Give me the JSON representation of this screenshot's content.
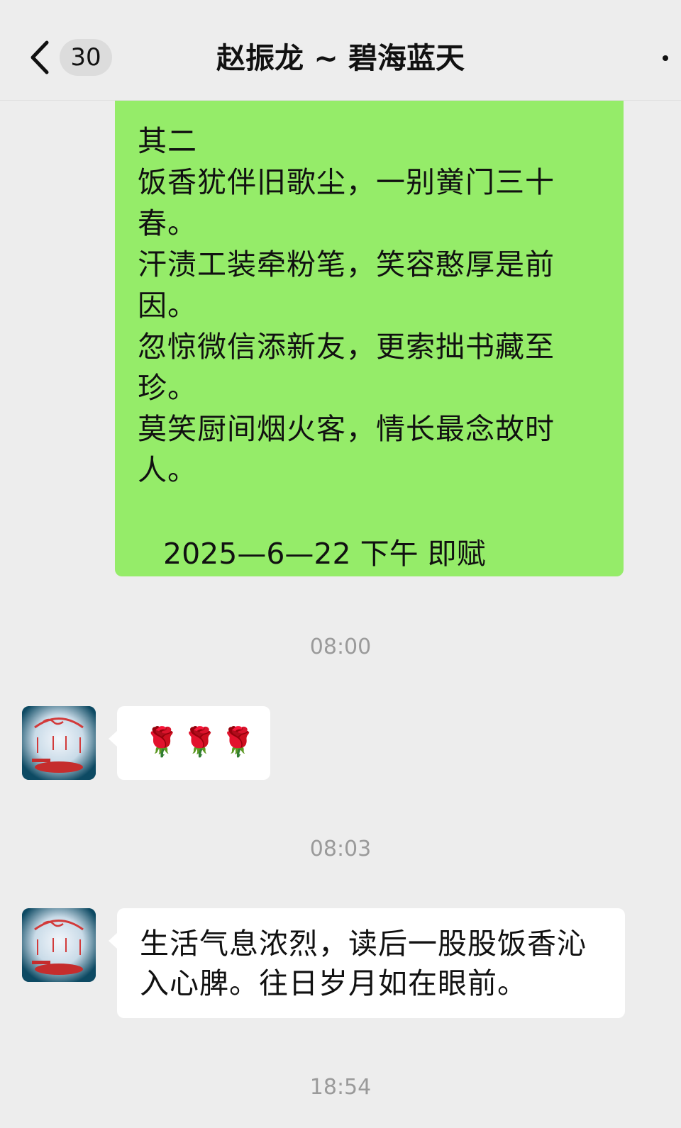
{
  "header": {
    "back_label": "<",
    "unread_count": "30",
    "title": "赵振龙 ~ 碧海蓝天",
    "more_icon": "more-dots-icon"
  },
  "sent_message": {
    "lines": [
      "其二",
      "饭香犹伴旧歌尘，一别黉门三十",
      "春。",
      "汗渍工装牵粉笔，笑容憨厚是前",
      "因。",
      "忽惊微信添新友，更索拙书藏至",
      "珍。",
      "莫笑厨间烟火客，情长最念故时",
      "人。"
    ],
    "signature": "2025—6—22 下午 即赋"
  },
  "timestamps": [
    "08:00",
    "08:03",
    "18:54"
  ],
  "received_messages": [
    {
      "text": "🌹🌹🌹"
    },
    {
      "lines": [
        "生活气息浓烈，读后一股股饭香沁",
        "入心脾。往日岁月如在眼前。"
      ]
    }
  ],
  "colors": {
    "background": "#ededed",
    "sent_bubble": "#95ec69",
    "received_bubble": "#ffffff",
    "timestamp": "#9a9a9a"
  }
}
